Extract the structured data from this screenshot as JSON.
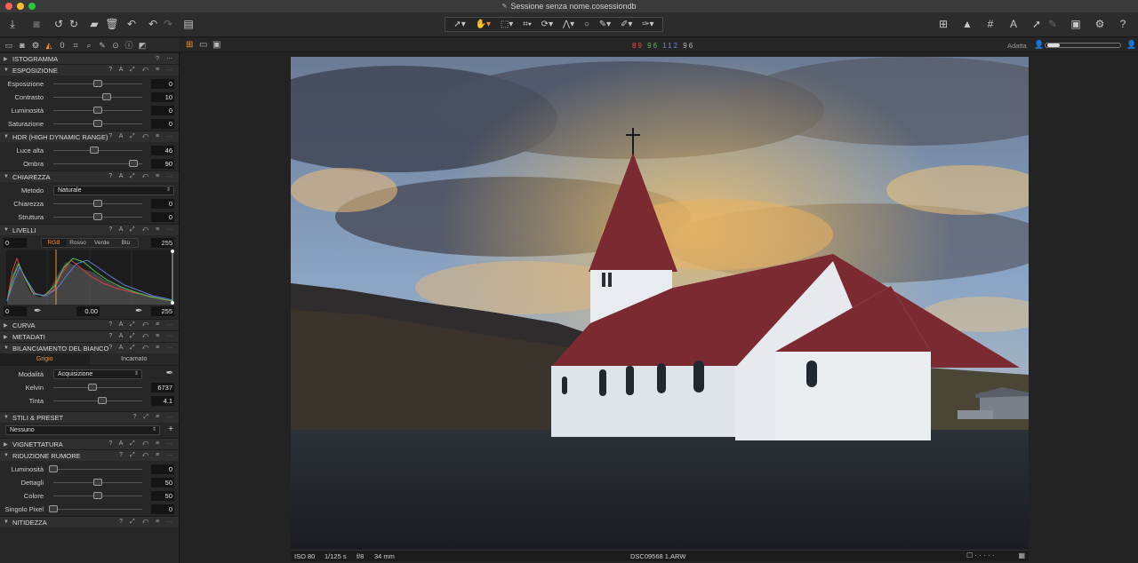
{
  "window": {
    "title": "Sessione senza nome.cosessiondb"
  },
  "colors": {
    "accent": "#f0913a",
    "close": "#ff5f57",
    "minimize": "#febc2e",
    "zoom": "#28c840"
  },
  "readout": {
    "r": "89",
    "g": "96",
    "b": "112",
    "l": "96"
  },
  "zoom_control": {
    "label": "Adatta"
  },
  "panels": {
    "istogramma": {
      "title": "ISTOGRAMMA"
    },
    "esposizione": {
      "title": "ESPOSIZIONE",
      "rows": [
        {
          "label": "Esposizione",
          "value": "0",
          "level": 0.5
        },
        {
          "label": "Contrasto",
          "value": "10",
          "level": 0.6
        },
        {
          "label": "Luminosità",
          "value": "0",
          "level": 0.5
        },
        {
          "label": "Saturazione",
          "value": "0",
          "level": 0.5
        }
      ]
    },
    "hdr": {
      "title": "HDR (HIGH DYNAMIC RANGE)",
      "rows": [
        {
          "label": "Luce alta",
          "value": "46",
          "level": 0.46
        },
        {
          "label": "Ombra",
          "value": "90",
          "level": 0.9
        }
      ]
    },
    "chiarezza": {
      "title": "CHIAREZZA",
      "method_label": "Metodo",
      "method_value": "Naturale",
      "rows": [
        {
          "label": "Chiarezza",
          "value": "0",
          "level": 0.5
        },
        {
          "label": "Struttura",
          "value": "0",
          "level": 0.5
        }
      ]
    },
    "livelli": {
      "title": "LIVELLI",
      "input_low": "0",
      "input_high": "255",
      "channels": [
        "RGB",
        "Rosso",
        "Verde",
        "Blu"
      ],
      "output_low": "0",
      "midpoint": "0.00",
      "output_high": "255"
    },
    "curva": {
      "title": "CURVA"
    },
    "metadati": {
      "title": "METADATI"
    },
    "bilanciamento": {
      "title": "BILANCIAMENTO DEL BIANCO",
      "tabs": [
        "Grigio",
        "Incarnato"
      ],
      "mode_label": "Modalità",
      "mode_value": "Acquisizione",
      "rows": [
        {
          "label": "Kelvin",
          "value": "6737",
          "level": 0.44
        },
        {
          "label": "Tinta",
          "value": "4.1",
          "level": 0.55
        }
      ]
    },
    "stili": {
      "title": "STILI & PRESET",
      "preset_value": "Nessuno"
    },
    "vignettatura": {
      "title": "VIGNETTATURA"
    },
    "rumore": {
      "title": "RIDUZIONE RUMORE",
      "rows": [
        {
          "label": "Luminosità",
          "value": "0",
          "level": 0.0
        },
        {
          "label": "Dettagli",
          "value": "50",
          "level": 0.5
        },
        {
          "label": "Colore",
          "value": "50",
          "level": 0.5
        },
        {
          "label": "Singolo Pixel",
          "value": "0",
          "level": 0.0
        }
      ]
    },
    "nitidezza": {
      "title": "NITIDEZZA"
    }
  },
  "photo_info": {
    "iso": "ISO 80",
    "shutter": "1/125 s",
    "aperture": "f/8",
    "focal": "34 mm",
    "filename": "DSC09568 1.ARW"
  }
}
